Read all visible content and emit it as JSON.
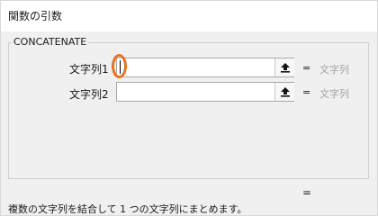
{
  "window": {
    "title": "関数の引数"
  },
  "function": {
    "name": "CONCATENATE"
  },
  "arguments": [
    {
      "label": "文字列1",
      "value": "",
      "equals": "=",
      "result": "文字列"
    },
    {
      "label": "文字列2",
      "value": "",
      "equals": "=",
      "result": "文字列"
    }
  ],
  "formula_result": {
    "equals": "="
  },
  "description": "複数の文字列を結合して 1 つの文字列にまとめます。",
  "colors": {
    "highlight": "#e8731f",
    "placeholder_gray": "#a3a3a3"
  }
}
